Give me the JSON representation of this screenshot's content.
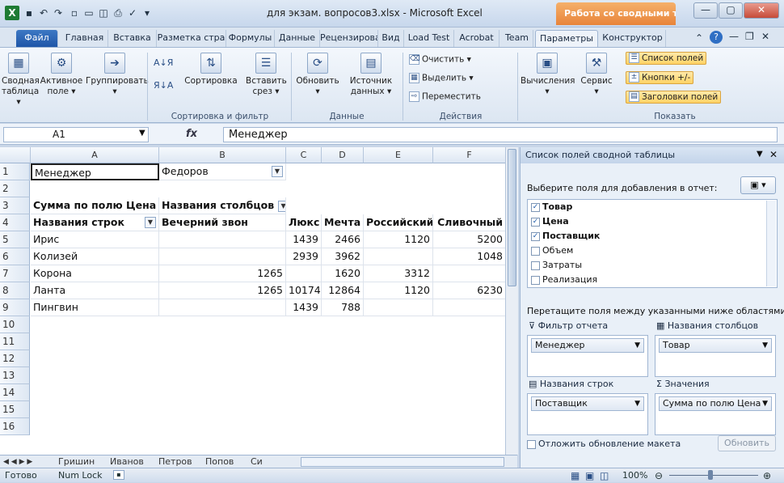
{
  "window": {
    "title": "для экзам. вопросов3.xlsx - Microsoft Excel",
    "context_tab": "Работа со сводными та...",
    "minimize": "—",
    "maximize": "▢",
    "close": "✕"
  },
  "ribbon_tabs": [
    "Файл",
    "Главная",
    "Вставка",
    "Разметка стра",
    "Формулы",
    "Данные",
    "Рецензирова",
    "Вид",
    "Load Test",
    "Acrobat",
    "Team",
    "Параметры",
    "Конструктор"
  ],
  "ribbon": {
    "pivot": "Сводная\nтаблица ▾",
    "active_field": "Активное\nполе ▾",
    "group": "Группировать\n▾",
    "sort": "Сортировка",
    "insert_slicer": "Вставить\nсрез ▾",
    "refresh": "Обновить\n▾",
    "source": "Источник\nданных ▾",
    "clear": "Очистить ▾",
    "select": "Выделить ▾",
    "move": "Переместить",
    "calc": "Вычисления\n▾",
    "tools": "Сервис\n▾",
    "field_list": "Список полей",
    "buttons": "Кнопки +/-",
    "headers": "Заголовки полей",
    "groups": {
      "sort_filter": "Сортировка и фильтр",
      "data": "Данные",
      "actions": "Действия",
      "show": "Показать"
    }
  },
  "formula_bar": {
    "name_box": "A1",
    "fx": "fx",
    "value": "Менеджер"
  },
  "grid": {
    "columns": [
      "A",
      "B",
      "C",
      "D",
      "E",
      "F"
    ],
    "row_numbers": [
      "1",
      "2",
      "3",
      "4",
      "5",
      "6",
      "7",
      "8",
      "9",
      "10",
      "11",
      "12",
      "13",
      "14",
      "15",
      "16"
    ],
    "filter_label": "Менеджер",
    "filter_value": "Федоров",
    "sum_label": "Сумма по полю Цена",
    "col_labels": "Названия столбцов",
    "row_labels": "Названия строк",
    "col_headers": [
      "Вечерний звон",
      "Люкс",
      "Мечта",
      "Российский",
      "Сливочный"
    ],
    "rows": [
      {
        "name": "Ирис",
        "b": "",
        "c": "1439",
        "d": "2466",
        "e": "1120",
        "f": "5200"
      },
      {
        "name": "Колизей",
        "b": "",
        "c": "2939",
        "d": "3962",
        "e": "",
        "f": "1048"
      },
      {
        "name": "Корона",
        "b": "1265",
        "c": "",
        "d": "1620",
        "e": "3312",
        "f": ""
      },
      {
        "name": "Ланта",
        "b": "1265",
        "c": "10174",
        "d": "12864",
        "e": "1120",
        "f": "6230"
      },
      {
        "name": "Пингвин",
        "b": "",
        "c": "1439",
        "d": "788",
        "e": "",
        "f": ""
      }
    ]
  },
  "sheet_tabs": [
    "Гришин",
    "Иванов",
    "Петров",
    "Попов",
    "Си"
  ],
  "status": {
    "ready": "Готово",
    "numlock": "Num Lock",
    "zoom": "100%"
  },
  "panel": {
    "title": "Список полей сводной таблицы",
    "choose": "Выберите поля для добавления в отчет:",
    "fields": [
      {
        "name": "Товар",
        "checked": true
      },
      {
        "name": "Цена",
        "checked": true
      },
      {
        "name": "Поставщик",
        "checked": true
      },
      {
        "name": "Объем",
        "checked": false
      },
      {
        "name": "Затраты",
        "checked": false
      },
      {
        "name": "Реализация",
        "checked": false
      }
    ],
    "drag_hint": "Перетащите поля между указанными ниже областями:",
    "report_filter": "Фильтр отчета",
    "col_names": "Названия столбцов",
    "row_names": "Названия строк",
    "values": "Значения",
    "filter_field": "Менеджер",
    "col_field": "Товар",
    "row_field": "Поставщик",
    "value_field": "Сумма по полю Цена",
    "defer": "Отложить обновление макета",
    "update": "Обновить"
  }
}
